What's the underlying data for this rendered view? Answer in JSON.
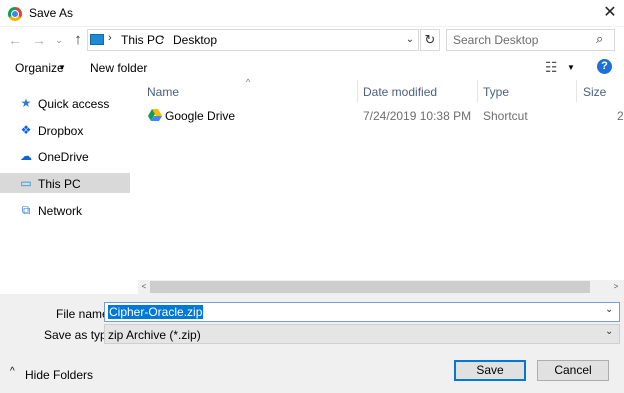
{
  "window": {
    "title": "Save As",
    "close_glyph": "✕",
    "icon": "chrome-icon"
  },
  "address": {
    "back_glyph": "←",
    "forward_glyph": "→",
    "history_glyph": "⌄",
    "up_glyph": "↑",
    "sep_glyph": "›",
    "breadcrumb": [
      "This PC",
      "Desktop"
    ],
    "dropdown_glyph": "⌄",
    "refresh_glyph": "↻"
  },
  "search": {
    "placeholder": "Search Desktop",
    "icon": "search-icon"
  },
  "toolbar": {
    "organize_label": "Organize",
    "caret": "▼",
    "new_folder_label": "New folder",
    "view_glyph": "☷",
    "help_glyph": "?"
  },
  "sidebar": {
    "items": [
      {
        "label": "Quick access",
        "icon": "star-icon",
        "glyph": "★",
        "color": "#2b7cd3"
      },
      {
        "label": "Dropbox",
        "icon": "dropbox-icon",
        "glyph": "❖",
        "color": "#0061fe"
      },
      {
        "label": "OneDrive",
        "icon": "cloud-icon",
        "glyph": "☁",
        "color": "#0a64d6"
      },
      {
        "label": "This PC",
        "icon": "computer-icon",
        "glyph": "▭",
        "color": "#1e8ad6",
        "selected": true
      },
      {
        "label": "Network",
        "icon": "network-icon",
        "glyph": "⧉",
        "color": "#2b7cd3"
      }
    ]
  },
  "columns": {
    "name": "Name",
    "date": "Date modified",
    "type": "Type",
    "size": "Size",
    "sort_glyph": "^"
  },
  "files": [
    {
      "name": "Google Drive",
      "date": "7/24/2019 10:38 PM",
      "type": "Shortcut",
      "size": "2",
      "icon": "google-drive-icon"
    }
  ],
  "scrollbar": {
    "left_glyph": "<",
    "right_glyph": ">"
  },
  "form": {
    "filename_label": "File name:",
    "filename_value": "Cipher-Oracle.zip",
    "saveas_label": "Save as type:",
    "saveas_value": "zip Archive (*.zip)",
    "dropdown_glyph": "⌄"
  },
  "footer": {
    "hide_folders_label": "Hide Folders",
    "hide_caret": "^",
    "save_label": "Save",
    "cancel_label": "Cancel"
  },
  "colors": {
    "accent": "#0078d7",
    "selection_bg": "#d9d9d9",
    "bottom_bg": "#f0f0f0"
  }
}
